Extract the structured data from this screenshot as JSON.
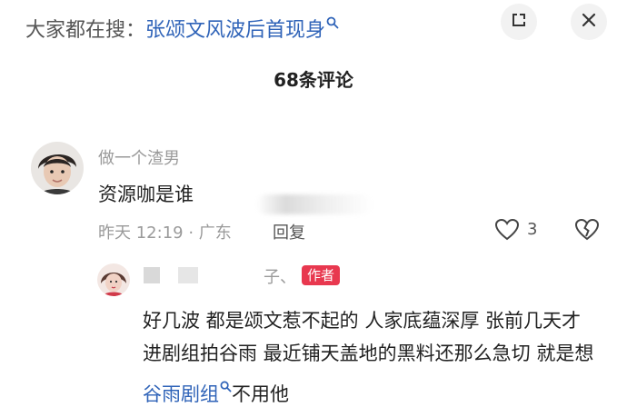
{
  "search_bar": {
    "prefix": "大家都在搜：",
    "topic": "张颂文风波后首现身"
  },
  "comments_header": {
    "title": "68条评论"
  },
  "comment": {
    "username": "做一个渣男",
    "text": "资源咖是谁",
    "meta": "昨天 12:19 · 广东",
    "reply_label": "回复",
    "like_count": "3"
  },
  "reply": {
    "username_tail": "子、",
    "author_badge": "作者",
    "text_before": "好几波 都是颂文惹不起的 人家底蕴深厚 张前几天才进剧组拍谷雨 最近铺天盖地的黑料还那么急切 就是想",
    "link_text": "谷雨剧组",
    "text_after": "不用他"
  },
  "colors": {
    "link_blue": "#2f63b8",
    "badge_red": "#e8384f",
    "muted_gray": "#9a9a9a"
  },
  "icons": {
    "expand": "expand-icon",
    "close": "close-icon",
    "like": "heart-icon",
    "dislike": "broken-heart-icon",
    "search": "search-icon"
  }
}
